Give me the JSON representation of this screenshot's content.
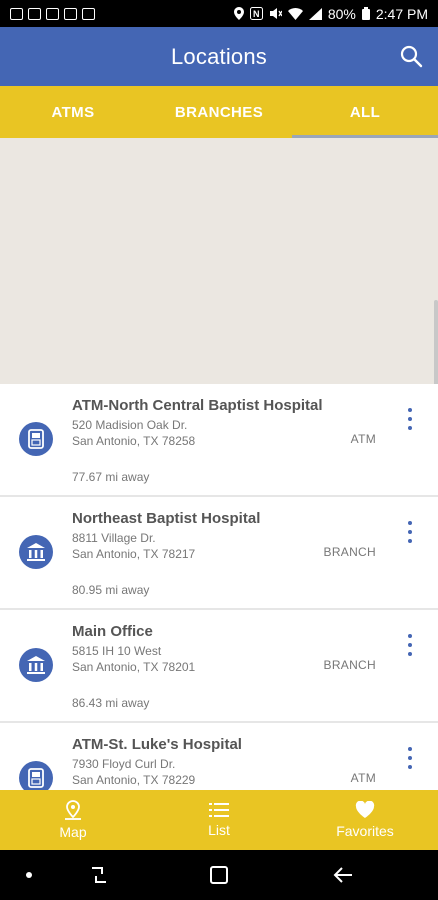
{
  "status_bar": {
    "battery": "80%",
    "time": "2:47 PM"
  },
  "app_bar": {
    "title": "Locations",
    "search_icon": "search-icon"
  },
  "tabs": [
    {
      "label": "ATMS",
      "active": false
    },
    {
      "label": "BRANCHES",
      "active": false
    },
    {
      "label": "ALL",
      "active": true
    }
  ],
  "locations": [
    {
      "name": "ATM-North Central Baptist Hospital",
      "address1": "520 Madision Oak Dr.",
      "address2": "San Antonio, TX 78258",
      "distance": "77.67 mi away",
      "type": "ATM",
      "icon": "atm-icon"
    },
    {
      "name": "Northeast Baptist Hospital",
      "address1": "8811 Village Dr.",
      "address2": "San Antonio, TX 78217",
      "distance": "80.95 mi away",
      "type": "BRANCH",
      "icon": "bank-icon"
    },
    {
      "name": "Main Office",
      "address1": "5815 IH 10 West",
      "address2": "San Antonio, TX 78201",
      "distance": "86.43 mi away",
      "type": "BRANCH",
      "icon": "bank-icon"
    },
    {
      "name": "ATM-St. Luke's Hospital",
      "address1": "7930 Floyd Curl Dr.",
      "address2": "San Antonio, TX 78229",
      "distance": "",
      "type": "ATM",
      "icon": "atm-icon"
    }
  ],
  "bottom_nav": [
    {
      "label": "Map",
      "icon": "map-pin-icon"
    },
    {
      "label": "List",
      "icon": "list-icon"
    },
    {
      "label": "Favorites",
      "icon": "heart-icon"
    }
  ],
  "colors": {
    "primary": "#4466b4",
    "accent": "#e9c523",
    "map": "#ebe7e1"
  }
}
